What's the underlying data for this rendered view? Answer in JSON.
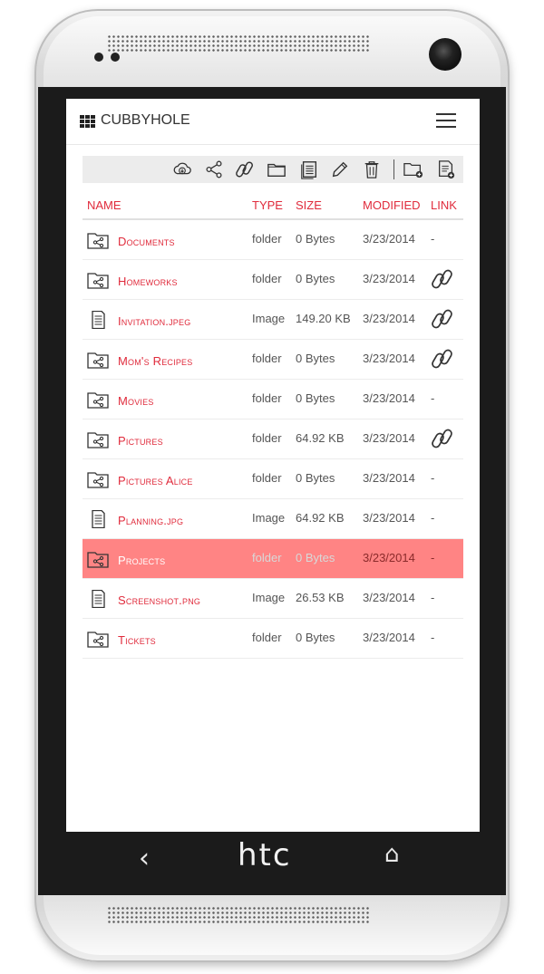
{
  "device": {
    "brand": "htc"
  },
  "app": {
    "title": "CUBBYHOLE"
  },
  "toolbar": {
    "actions": [
      "download-icon",
      "share-icon",
      "link-icon",
      "folder-icon",
      "notes-icon",
      "pencil-icon",
      "trash-icon",
      "new-folder-icon",
      "new-file-icon"
    ]
  },
  "table": {
    "headers": {
      "name": "NAME",
      "type": "TYPE",
      "size": "SIZE",
      "modified": "MODIFIED",
      "link": "LINK"
    },
    "rows": [
      {
        "name": "Documents",
        "type": "folder",
        "size": "0 Bytes",
        "modified": "3/23/2014",
        "link": "-",
        "kind": "folder",
        "has_link": false,
        "selected": false
      },
      {
        "name": "Homeworks",
        "type": "folder",
        "size": "0 Bytes",
        "modified": "3/23/2014",
        "link": "",
        "kind": "folder",
        "has_link": true,
        "selected": false
      },
      {
        "name": "Invitation.jpeg",
        "type": "Image",
        "size": "149.20 KB",
        "modified": "3/23/2014",
        "link": "",
        "kind": "file",
        "has_link": true,
        "selected": false
      },
      {
        "name": "Mom's Recipes",
        "type": "folder",
        "size": "0 Bytes",
        "modified": "3/23/2014",
        "link": "",
        "kind": "folder",
        "has_link": true,
        "selected": false
      },
      {
        "name": "Movies",
        "type": "folder",
        "size": "0 Bytes",
        "modified": "3/23/2014",
        "link": "-",
        "kind": "folder",
        "has_link": false,
        "selected": false
      },
      {
        "name": "Pictures",
        "type": "folder",
        "size": "64.92 KB",
        "modified": "3/23/2014",
        "link": "",
        "kind": "folder",
        "has_link": true,
        "selected": false
      },
      {
        "name": "Pictures Alice",
        "type": "folder",
        "size": "0 Bytes",
        "modified": "3/23/2014",
        "link": "-",
        "kind": "folder",
        "has_link": false,
        "selected": false
      },
      {
        "name": "Planning.jpg",
        "type": "Image",
        "size": "64.92 KB",
        "modified": "3/23/2014",
        "link": "-",
        "kind": "file",
        "has_link": false,
        "selected": false
      },
      {
        "name": "Projects",
        "type": "folder",
        "size": "0 Bytes",
        "modified": "3/23/2014",
        "link": "-",
        "kind": "folder",
        "has_link": false,
        "selected": true
      },
      {
        "name": "Screenshot.png",
        "type": "Image",
        "size": "26.53 KB",
        "modified": "3/23/2014",
        "link": "-",
        "kind": "file",
        "has_link": false,
        "selected": false
      },
      {
        "name": "Tickets",
        "type": "folder",
        "size": "0 Bytes",
        "modified": "3/23/2014",
        "link": "-",
        "kind": "folder",
        "has_link": false,
        "selected": false
      }
    ]
  },
  "colors": {
    "accent": "#e02b3c",
    "selected_row": "#ff8484",
    "toolbar_bg": "#ececec"
  }
}
